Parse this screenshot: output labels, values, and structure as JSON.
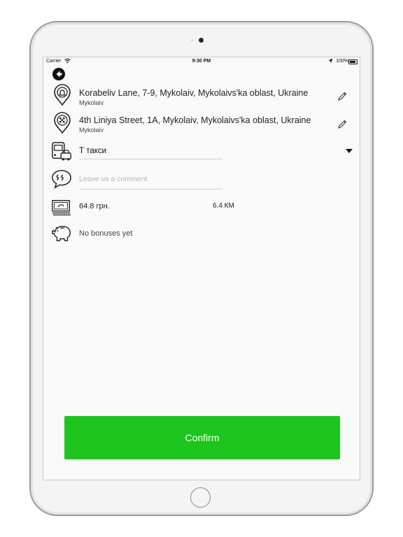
{
  "status_bar": {
    "carrier": "Carrier",
    "time": "9:30 PM",
    "battery": "100%"
  },
  "route": {
    "from": {
      "address": "Korabeliv Lane, 7-9, Mykolaiv, Mykolaivs'ka oblast, Ukraine",
      "city": "Mykolaiv",
      "icon": "start-pin-icon"
    },
    "to": {
      "address": "4th Liniya Street, 1A, Mykolaiv, Mykolaivs'ka oblast, Ukraine",
      "city": "Mykolaiv",
      "icon": "finish-flag-pin-icon"
    }
  },
  "tariff": {
    "value": "Т такси",
    "icon": "bus-car-icon"
  },
  "comment": {
    "placeholder": "Leave us a comment",
    "value": "",
    "icon": "quote-bubble-icon"
  },
  "fare": {
    "price": "64.8 грн.",
    "distance": "6.4 КМ",
    "icon": "money-icon"
  },
  "bonuses": {
    "text": "No bonuses yet",
    "icon": "piggy-bank-icon"
  },
  "confirm_label": "Confirm",
  "colors": {
    "accent": "#1ec51e",
    "text": "#222222"
  }
}
